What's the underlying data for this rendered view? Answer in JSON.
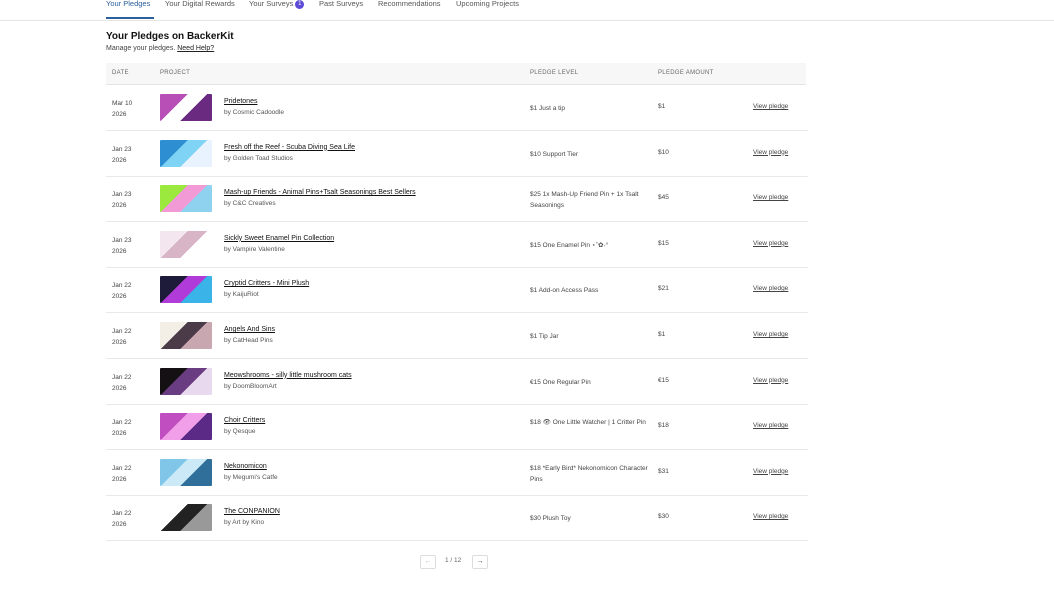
{
  "tabs": [
    {
      "label": "Your Pledges",
      "active": true
    },
    {
      "label": "Your Digital Rewards"
    },
    {
      "label": "Your Surveys",
      "badge": "1"
    },
    {
      "label": "Past Surveys"
    },
    {
      "label": "Recommendations"
    },
    {
      "label": "Upcoming Projects"
    }
  ],
  "page": {
    "title": "Your Pledges on BackerKit",
    "subtitle": "Manage your pledges.",
    "help_link": "Need Help?"
  },
  "table": {
    "headers": {
      "date": "DATE",
      "project": "PROJECT",
      "level": "PLEDGE LEVEL",
      "amount": "PLEDGE AMOUNT"
    },
    "view_label": "View pledge",
    "rows": [
      {
        "date_md": "Mar 10",
        "date_y": "2026",
        "title": "Pridetones",
        "creator": "by Cosmic Cadoodle",
        "level": "$1 Just a tip",
        "amount": "$1",
        "thumb": [
          "#b84fb6",
          "#ffffff",
          "#6a2a80"
        ]
      },
      {
        "date_md": "Jan 23",
        "date_y": "2026",
        "title": "Fresh off the Reef - Scuba Diving Sea Life",
        "creator": "by Golden Toad Studios",
        "level": "$10 Support Tier",
        "amount": "$10",
        "thumb": [
          "#2d8fd1",
          "#7fd3f5",
          "#e8f3ff"
        ]
      },
      {
        "date_md": "Jan 23",
        "date_y": "2026",
        "title": "Mash-up Friends - Animal Pins+Tsalt Seasonings Best Sellers",
        "creator": "by C&C Creatives",
        "level": "$25 1x Mash-Up Friend Pin + 1x Tsalt Seasonings",
        "amount": "$45",
        "thumb": [
          "#9be83f",
          "#f29ad6",
          "#8fd2f0"
        ]
      },
      {
        "date_md": "Jan 23",
        "date_y": "2026",
        "title": "Sickly Sweet Enamel Pin Collection",
        "creator": "by Vampire Valentine",
        "level": "$15 One Enamel Pin ⋆˚✿˖°",
        "amount": "$15",
        "thumb": [
          "#f3e6ee",
          "#d7b4c6",
          "#ffffff"
        ]
      },
      {
        "date_md": "Jan 22",
        "date_y": "2026",
        "title": "Cryptid Critters - Mini Plush",
        "creator": "by KaijuRiot",
        "level": "$1 Add-on Access Pass",
        "amount": "$21",
        "thumb": [
          "#1e1b3a",
          "#b13bd8",
          "#3ab3e8"
        ]
      },
      {
        "date_md": "Jan 22",
        "date_y": "2026",
        "title": "Angels And Sins",
        "creator": "by CatHead Pins",
        "level": "$1 Tip Jar",
        "amount": "$1",
        "thumb": [
          "#f4efe6",
          "#4b3a48",
          "#c9a7b0"
        ]
      },
      {
        "date_md": "Jan 22",
        "date_y": "2026",
        "title": "Meowshrooms - silly little mushroom cats",
        "creator": "by DoomBloomArt",
        "level": "€15 One Regular Pin",
        "amount": "€15",
        "thumb": [
          "#141014",
          "#6a3d82",
          "#e9d9ef"
        ]
      },
      {
        "date_md": "Jan 22",
        "date_y": "2026",
        "title": "Choir Critters",
        "creator": "by Qesque",
        "level": "$18 👁 One Little Watcher | 1 Critter Pin",
        "amount": "$18",
        "thumb": [
          "#c04ec0",
          "#f09fe8",
          "#5b2a86"
        ]
      },
      {
        "date_md": "Jan 22",
        "date_y": "2026",
        "title": "Nekonomicon",
        "creator": "by Megumi's Catfe",
        "level": "$18 *Early Bird* Nekonomicon Character Pins",
        "amount": "$31",
        "thumb": [
          "#7fc6e8",
          "#cbe9f7",
          "#2f6f9a"
        ]
      },
      {
        "date_md": "Jan 22",
        "date_y": "2026",
        "title": "The CONPANION",
        "creator": "by Art by Kino",
        "level": "$30 Plush Toy",
        "amount": "$30",
        "thumb": [
          "#ffffff",
          "#222222",
          "#999999"
        ]
      }
    ]
  },
  "pagination": {
    "prev": "←",
    "next": "→",
    "label": "1 / 12"
  }
}
